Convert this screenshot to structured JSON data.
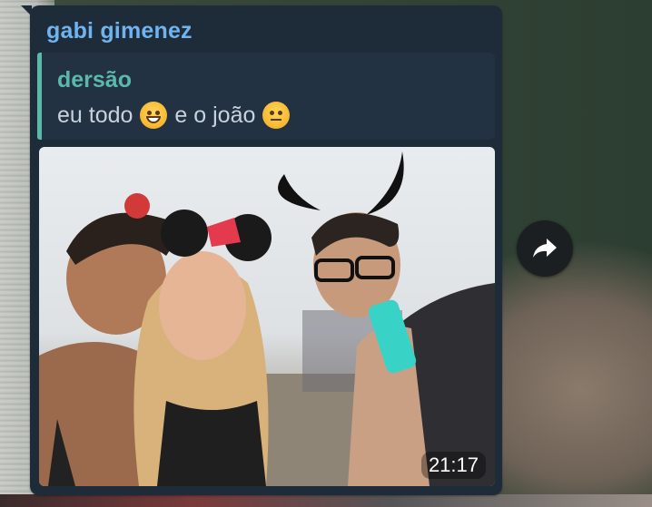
{
  "message": {
    "sender": "gabi gimenez",
    "reply": {
      "author": "dersão",
      "text_before": "eu todo",
      "emoji_1": "grinning-face-emoji",
      "text_middle": "e o joão",
      "emoji_2": "neutral-face-emoji"
    },
    "photo": {
      "description_icon": "selfie-photo",
      "time": "21:17"
    }
  },
  "actions": {
    "forward_icon": "forward-arrow-icon"
  },
  "colors": {
    "bubble": "#1e2c3a",
    "sender_name": "#6fb3ef",
    "reply_accent": "#5bb9a9",
    "reply_text": "#c8d2dc"
  }
}
